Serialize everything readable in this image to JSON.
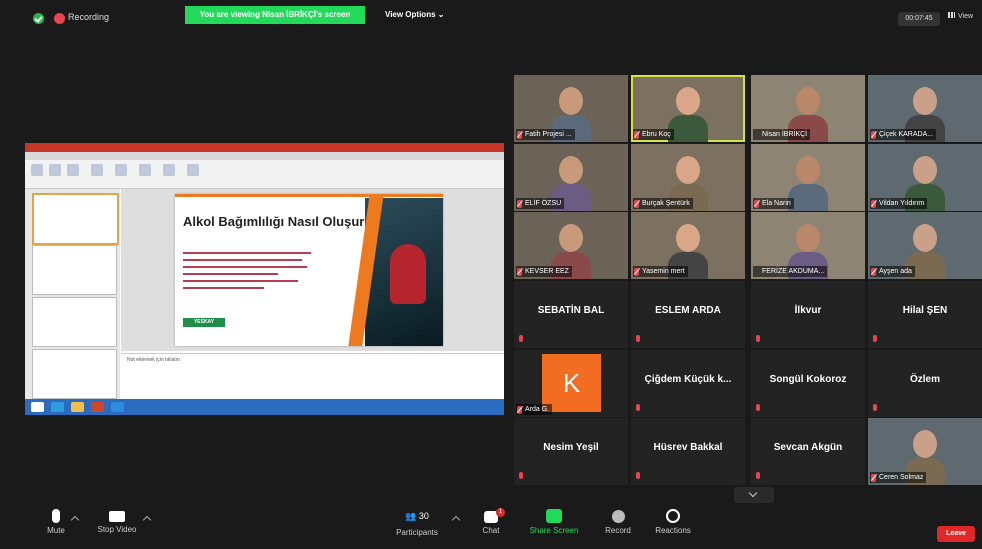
{
  "top": {
    "recording_label": "Recording",
    "share_banner": "You are viewing Nisan İBRİKÇİ's screen",
    "view_options": "View Options ⌄",
    "timer": "00:07:45",
    "view_label": "View"
  },
  "slide": {
    "title": "Alkol Bağımlılığı Nasıl Oluşur?",
    "logo": "YESKAY",
    "notes": "Not eklemek için tıklatın"
  },
  "participants": [
    {
      "name": "Fatih Projesi ...",
      "video": true,
      "muted": true
    },
    {
      "name": "Ebru Koç",
      "video": true,
      "muted": true,
      "active": true
    },
    {
      "name": "Nisan İBRİKÇİ",
      "video": true,
      "muted": false
    },
    {
      "name": "Çiçek KARADA...",
      "video": true,
      "muted": true
    },
    {
      "name": "ELİF ÖZSU",
      "video": true,
      "muted": true
    },
    {
      "name": "Burçak Şentürk",
      "video": true,
      "muted": true
    },
    {
      "name": "Ela Narin",
      "video": true,
      "muted": true
    },
    {
      "name": "Vildan Yıldırım",
      "video": true,
      "muted": true
    },
    {
      "name": "KEVSER EEZ",
      "video": true,
      "muted": true
    },
    {
      "name": "Yasemin mert",
      "video": true,
      "muted": true
    },
    {
      "name": "FERİZE AKDUMA...",
      "video": true,
      "muted": false
    },
    {
      "name": "Ayşen ada",
      "video": true,
      "muted": true
    },
    {
      "name": "SEBATİN BAL",
      "video": false
    },
    {
      "name": "ESLEM ARDA",
      "video": false
    },
    {
      "name": "İlkvur",
      "video": false
    },
    {
      "name": "Hilal ŞEN",
      "video": false
    },
    {
      "name": "Arda G.",
      "video": false,
      "avatar": "K"
    },
    {
      "name": "Çiğdem Küçük k...",
      "video": false
    },
    {
      "name": "Songül Kokoroz",
      "video": false
    },
    {
      "name": "Özlem",
      "video": false
    },
    {
      "name": "Nesim Yeşil",
      "video": false
    },
    {
      "name": "Hüsrev Bakkal",
      "video": false
    },
    {
      "name": "Sevcan Akgün",
      "video": false
    },
    {
      "name": "Ceren Solmaz",
      "video": true,
      "muted": true
    }
  ],
  "toolbar": {
    "mute": "Mute",
    "stop_video": "Stop Video",
    "participants": "Participants",
    "participants_count": "30",
    "chat": "Chat",
    "chat_badge": "1",
    "share_screen": "Share Screen",
    "record": "Record",
    "reactions": "Reactions",
    "leave": "Leave"
  },
  "colors": {
    "share_green": "#23d959",
    "active_speaker": "#d0e348",
    "leave_red": "#e02828",
    "avatar_orange": "#f26d21"
  }
}
